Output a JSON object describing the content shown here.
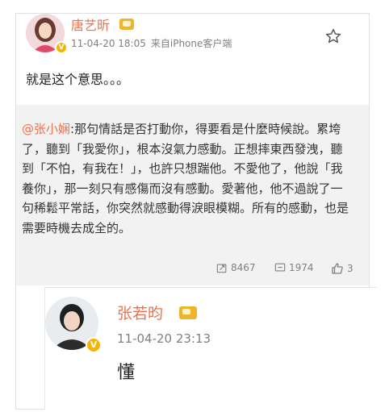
{
  "post": {
    "author": "唐艺昕",
    "time": "11-04-20 18:05",
    "source": "来自iPhone客户端",
    "text": "就是这个意思。。。",
    "icons": {
      "follow": "star-icon",
      "badge": "vip-badge-icon",
      "verified": "verified-v-icon"
    }
  },
  "quoted": {
    "mention": "@张小娴",
    "text": ":那句情話是否打動你，得要看是什麼時候說。累垮了，聽到「我愛你」，根本沒氣力感動。正想摔東西發洩，聽到「不怕，有我在！」，也許只想踹他。不愛他了，他說「我養你」，那一刻只有感傷而沒有感動。愛著他，他不過說了一句稀鬆平常話，你突然就感動得淚眼模糊。所有的感動，也是需要時機去成全的。",
    "reposts": "8467",
    "comments": "1974",
    "likes": "3",
    "icons": {
      "repost": "repost-icon",
      "comment": "comment-icon",
      "like": "thumbs-up-icon"
    }
  },
  "reply": {
    "author": "张若昀",
    "time": "11-04-20 23:13",
    "text": "懂",
    "icons": {
      "badge": "vip-badge-icon",
      "verified": "verified-v-icon"
    }
  },
  "colors": {
    "username": "#eb7350",
    "meta": "#808080",
    "quote_bg": "#f2f2f2",
    "verified": "#f5b400"
  }
}
